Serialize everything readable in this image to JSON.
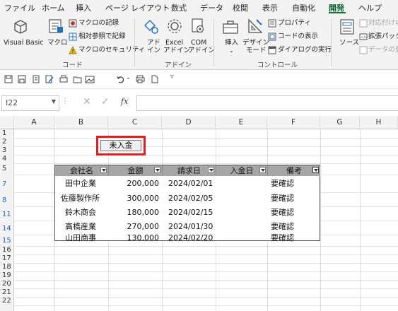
{
  "tabs": [
    "ファイル",
    "ホーム",
    "挿入",
    "ページ レイアウト",
    "数式",
    "データ",
    "校閲",
    "表示",
    "自動化",
    "開発",
    "ヘルプ"
  ],
  "active_tab": "開発",
  "ribbon": {
    "code": {
      "visual_basic": "Visual Basic",
      "macro": "マクロ",
      "record_macro": "マクロの記録",
      "relative_ref": "相対参照で記録",
      "macro_security": "マクロのセキュリティ",
      "label": "コード"
    },
    "addins": {
      "addin_1": "アド",
      "addin_2": "イン",
      "excel_addin_1": "Excel",
      "excel_addin_2": "アドイン",
      "com_addin_1": "COM",
      "com_addin_2": "アドイン",
      "label": "アドイン"
    },
    "controls": {
      "insert": "挿入",
      "design_1": "デザイン",
      "design_2": "モード",
      "properties": "プロパティ",
      "view_code": "コードの表示",
      "run_dialog": "ダイアログの実行",
      "label": "コントロール"
    },
    "xml": {
      "source": "ソース",
      "map_props": "対応付けの",
      "expansion_pack": "拡張パック",
      "refresh_data": "データの更"
    }
  },
  "formula_bar": {
    "name_box": "I22",
    "fx": "fx",
    "formula": ""
  },
  "sheet": {
    "columns": [
      "A",
      "B",
      "C",
      "D",
      "E",
      "F",
      "G",
      "H"
    ],
    "rows": [
      "1",
      "2",
      "3",
      "4",
      "5",
      "7",
      "8",
      "11",
      "14",
      "15",
      "16",
      "17",
      "18",
      "19",
      "20",
      "21",
      "22"
    ],
    "button_label": "未入金",
    "table_headers": [
      "会社名",
      "金額",
      "請求日",
      "入金日",
      "備考"
    ],
    "table_rows": [
      {
        "company": "田中企業",
        "amount": "200,000",
        "date": "2024/02/01",
        "paid": "",
        "note": "要確認"
      },
      {
        "company": "佐藤製作所",
        "amount": "300,000",
        "date": "2024/02/05",
        "paid": "",
        "note": "要確認"
      },
      {
        "company": "鈴木商会",
        "amount": "180,000",
        "date": "2024/02/15",
        "paid": "",
        "note": "要確認"
      },
      {
        "company": "高橋産業",
        "amount": "270,000",
        "date": "2024/01/30",
        "paid": "",
        "note": "要確認"
      },
      {
        "company": "山田商事",
        "amount": "130,000",
        "date": "2024/02/20",
        "paid": "",
        "note": "要確認"
      }
    ]
  },
  "colors": {
    "accent": "#107c41",
    "table_header": "#a6a6a6",
    "button_highlight": "#e02020",
    "filtered_row_number": "#1a64c8"
  }
}
